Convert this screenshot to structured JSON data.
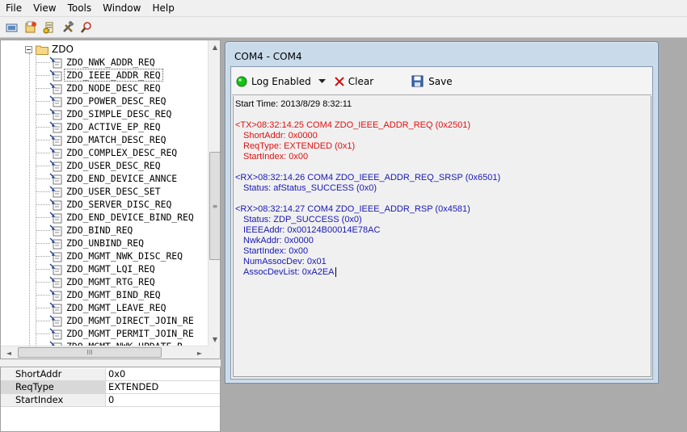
{
  "menu": [
    "File",
    "View",
    "Tools",
    "Window",
    "Help"
  ],
  "toolbar": {
    "icons": [
      "open-device-icon",
      "load-icon",
      "script-icon",
      "tools-icon",
      "find-device-icon"
    ]
  },
  "tree": {
    "folder_label": "ZDO",
    "items": [
      "ZDO_NWK_ADDR_REQ",
      "ZDO_IEEE_ADDR_REQ",
      "ZDO_NODE_DESC_REQ",
      "ZDO_POWER_DESC_REQ",
      "ZDO_SIMPLE_DESC_REQ",
      "ZDO_ACTIVE_EP_REQ",
      "ZDO_MATCH_DESC_REQ",
      "ZDO_COMPLEX_DESC_REQ",
      "ZDO_USER_DESC_REQ",
      "ZDO_END_DEVICE_ANNCE",
      "ZDO_USER_DESC_SET",
      "ZDO_SERVER_DISC_REQ",
      "ZDO_END_DEVICE_BIND_REQ",
      "ZDO_BIND_REQ",
      "ZDO_UNBIND_REQ",
      "ZDO_MGMT_NWK_DISC_REQ",
      "ZDO_MGMT_LQI_REQ",
      "ZDO_MGMT_RTG_REQ",
      "ZDO_MGMT_BIND_REQ",
      "ZDO_MGMT_LEAVE_REQ",
      "ZDO_MGMT_DIRECT_JOIN_RE",
      "ZDO_MGMT_PERMIT_JOIN_RE",
      "ZDO_MGMT_NWK_UPDATE_R"
    ],
    "selected_index": 1
  },
  "scrollbars": {
    "up": "▲",
    "down": "▼",
    "left": "◄",
    "right": "►",
    "grip_v": "≡",
    "grip_h": "III"
  },
  "properties": [
    {
      "name": "ShortAddr",
      "value": "0x0"
    },
    {
      "name": "ReqType",
      "value": "EXTENDED"
    },
    {
      "name": "StartIndex",
      "value": "0"
    }
  ],
  "window": {
    "title": "COM4 - COM4",
    "log_enabled_label": "Log Enabled",
    "clear_label": "Clear",
    "save_label": "Save"
  },
  "log": {
    "start_time": "Start Time: 2013/8/29 8:32:11",
    "colors": {
      "tx": "#e01010",
      "rx": "#1818b8"
    },
    "blocks": [
      {
        "kind": "tx",
        "header": "<TX>08:32:14.25 COM4 ZDO_IEEE_ADDR_REQ (0x2501)",
        "lines": [
          "ShortAddr: 0x0000",
          "ReqType: EXTENDED (0x1)",
          "StartIndex: 0x00"
        ]
      },
      {
        "kind": "rx",
        "header": "<RX>08:32:14.26 COM4 ZDO_IEEE_ADDR_REQ_SRSP (0x6501)",
        "lines": [
          "Status: afStatus_SUCCESS (0x0)"
        ]
      },
      {
        "kind": "rx",
        "header": "<RX>08:32:14.27 COM4 ZDO_IEEE_ADDR_RSP (0x4581)",
        "lines": [
          "Status: ZDP_SUCCESS (0x0)",
          "IEEEAddr: 0x00124B00014E78AC",
          "NwkAddr: 0x0000",
          "StartIndex: 0x00",
          "NumAssocDev: 0x01",
          "AssocDevList: 0xA2EA"
        ]
      }
    ]
  }
}
